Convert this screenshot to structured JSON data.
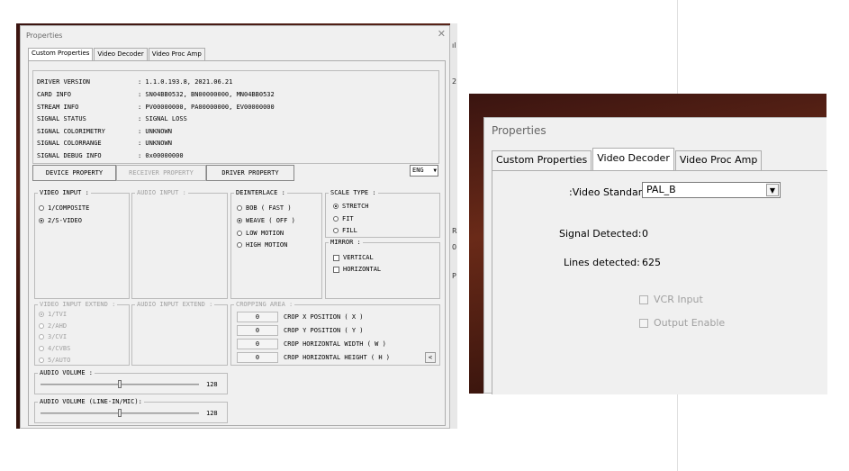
{
  "left": {
    "title": "Properties",
    "tabs": [
      "Custom Properties",
      "Video Decoder",
      "Video Proc Amp"
    ],
    "info": [
      {
        "label": "DRIVER VERSION",
        "value": ": 1.1.0.193.8, 2021.06.21"
      },
      {
        "label": "CARD INFO",
        "value": ": SN04BB0532, BN00000000, MN04BB0532"
      },
      {
        "label": "STREAM INFO",
        "value": ": PV00000000, PA00000000, EV00000000"
      },
      {
        "label": "SIGNAL STATUS",
        "value": ": SIGNAL LOSS"
      },
      {
        "label": "SIGNAL COLORIMETRY",
        "value": ": UNKNOWN"
      },
      {
        "label": "SIGNAL COLORRANGE",
        "value": ": UNKNOWN"
      },
      {
        "label": "SIGNAL DEBUG INFO",
        "value": ": 0x00000000"
      }
    ],
    "buttons": {
      "device": "DEVICE PROPERTY",
      "receiver": "RECEIVER PROPERTY",
      "driver": "DRIVER PROPERTY"
    },
    "language": "ENG",
    "video_input": {
      "title": "VIDEO INPUT :",
      "options": [
        "1/COMPOSITE",
        "2/S-VIDEO"
      ],
      "selected": "2/S-VIDEO"
    },
    "audio_input": {
      "title": "AUDIO INPUT :"
    },
    "deinterlace": {
      "title": "DEINTERLACE :",
      "options": [
        "BOB ( FAST )",
        "WEAVE ( OFF )",
        "LOW MOTION",
        "HIGH MOTION"
      ],
      "selected": "WEAVE ( OFF )"
    },
    "scale_type": {
      "title": "SCALE TYPE :",
      "options": [
        "STRETCH",
        "FIT",
        "FILL"
      ],
      "selected": "STRETCH"
    },
    "mirror": {
      "title": "MIRROR :",
      "options": [
        "VERTICAL",
        "HORIZONTAL"
      ]
    },
    "video_input_extend": {
      "title": "VIDEO INPUT EXTEND :",
      "options": [
        "1/TVI",
        "2/AHD",
        "3/CVI",
        "4/CVBS",
        "5/AUTO"
      ],
      "selected": "1/TVI"
    },
    "audio_input_extend": {
      "title": "AUDIO INPUT EXTEND :"
    },
    "cropping": {
      "title": "CROPPING AREA :",
      "rows": [
        {
          "value": "0",
          "label": "CROP X POSITION ( X )"
        },
        {
          "value": "0",
          "label": "CROP Y POSITION ( Y )"
        },
        {
          "value": "0",
          "label": "CROP HORIZONTAL WIDTH ( W )"
        },
        {
          "value": "0",
          "label": "CROP HORIZONTAL HEIGHT ( H )"
        }
      ],
      "scroll_glyph": "<"
    },
    "audio_volume": {
      "title": "AUDIO VOLUME :",
      "value": "128",
      "level": 0.5
    },
    "audio_volume_line": {
      "title": "AUDIO VOLUME (LINE-IN/MIC):",
      "value": "128",
      "level": 0.5
    },
    "strip_chars": [
      "ıl",
      "2",
      "R",
      "0",
      "P"
    ]
  },
  "right": {
    "title": "Properties",
    "tabs": [
      "Custom Properties",
      "Video Decoder",
      "Video Proc Amp"
    ],
    "video_standard_label": ":Video Standard",
    "video_standard_value": "PAL_B",
    "signal_detected_label": "Signal Detected:",
    "signal_detected_value": "0",
    "lines_detected_label": "Lines detected:",
    "lines_detected_value": "625",
    "vcr_input": "VCR Input",
    "output_enable": "Output Enable"
  },
  "colors": {
    "dialog_bg": "#f0f0f0",
    "disabled_text": "#a0a0a0",
    "backdrop": "#4a1c12"
  }
}
